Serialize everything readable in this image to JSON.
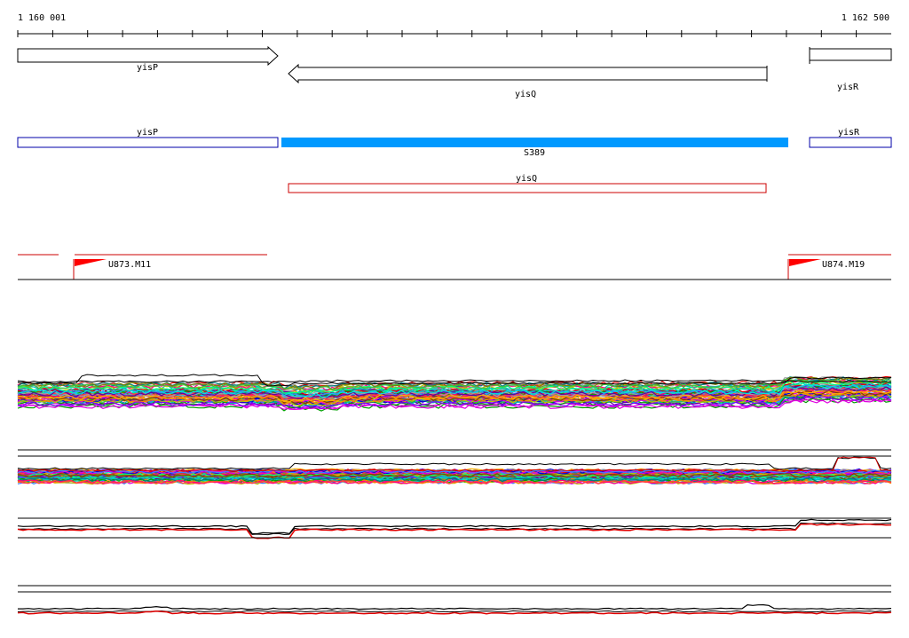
{
  "ruler": {
    "start_label": "1 160 001",
    "end_label": "1 162 500"
  },
  "genes": {
    "yisP": "yisP",
    "yisQ": "yisQ",
    "yisR": "yisR"
  },
  "features": {
    "yisP": "yisP",
    "S389": "S389",
    "yisR": "yisR",
    "yisQ": "yisQ"
  },
  "terminators": {
    "left": "U873.M11",
    "right": "U874.M19"
  },
  "colors": {
    "feature_blue": "#0000aa",
    "segment_blue": "#0099ff",
    "feature_red": "#cc0000",
    "flag_red": "#ff0000",
    "axis": "#000000"
  }
}
